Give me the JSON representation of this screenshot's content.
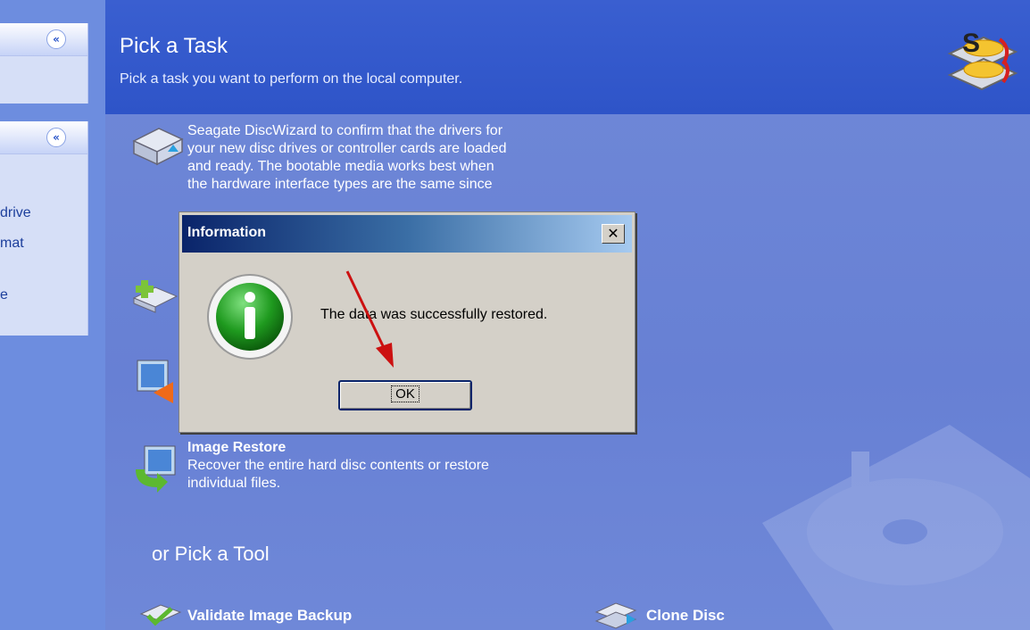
{
  "sidebar": {
    "items": [
      "drive",
      "mat",
      "e"
    ]
  },
  "header": {
    "title": "Pick a Task",
    "subtitle": "Pick a task you want to perform on the local computer."
  },
  "tasks": {
    "partial_text": [
      "Seagate DiscWizard to confirm that the drivers for",
      "your new disc drives or controller cards are loaded",
      "and ready. The bootable media works best when",
      "the hardware interface types are the same since"
    ],
    "image_restore": {
      "title": "Image Restore",
      "desc_line1": "Recover the entire hard disc contents or restore",
      "desc_line2": "individual files."
    }
  },
  "tools": {
    "heading": "or Pick a Tool",
    "validate": "Validate Image Backup",
    "clone": "Clone Disc"
  },
  "dialog": {
    "title": "Information",
    "close_glyph": "✕",
    "message": "The data was successfully restored.",
    "ok_label": "OK",
    "icon_letter": "i"
  },
  "colors": {
    "accent": "#2e54c8",
    "arrow": "#cc1111",
    "info_green": "#1f9a1f"
  }
}
